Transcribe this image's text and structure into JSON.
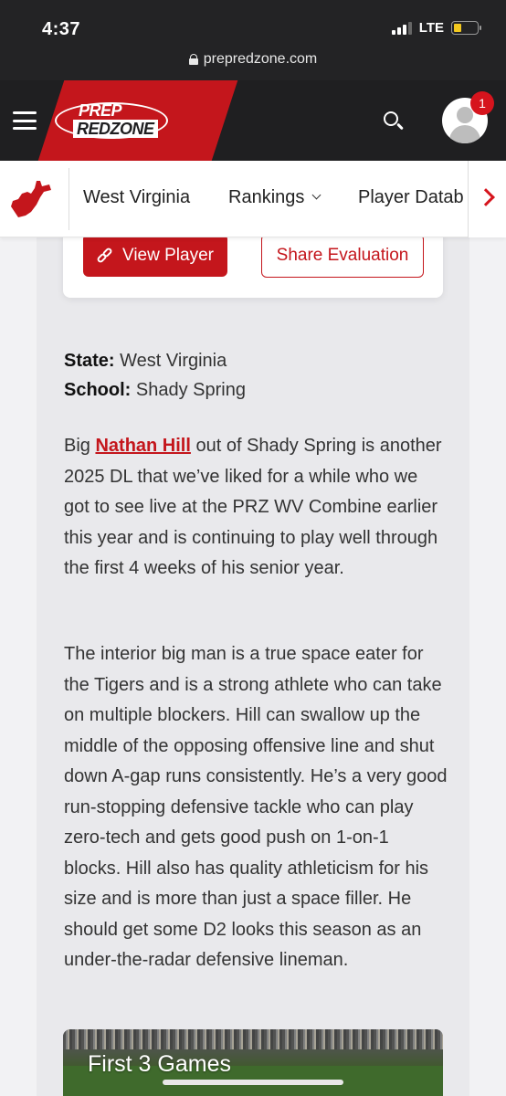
{
  "status_bar": {
    "time": "4:37",
    "network": "LTE",
    "battery_level": 0.35
  },
  "browser": {
    "url": "prepredzone.com"
  },
  "header": {
    "logo_line1": "PREP",
    "logo_line2": "REDZONE",
    "notification_count": "1"
  },
  "subnav": {
    "state_icon": "west-virginia-map-icon",
    "items": [
      "West Virginia",
      "Rankings",
      "Player Datab"
    ]
  },
  "evaluation": {
    "view_button": "View Player",
    "share_button": "Share Evaluation",
    "state_label": "State:",
    "state_value": "West Virginia",
    "school_label": "School:",
    "school_value": "Shady Spring",
    "para1_prefix": "Big ",
    "player_name": "Nathan Hill",
    "para1_suffix": " out of Shady Spring is another 2025 DL that we’ve liked for a while who we got to see live at the PRZ WV Combine earlier this year and is continuing to play well through the first 4 weeks of his senior year.",
    "para2": "The interior big man is a true space eater for the Tigers and is a strong athlete who can take on multiple blockers. Hill can swallow up the middle of the opposing offensive line and shut down A-gap runs consistently. He’s a very good run-stopping defensive tackle who can play zero-tech and gets good push on 1-on-1 blocks. Hill also has quality athleticism for his size and is more than just a space filler. He should get some D2 looks this season as an under-the-radar defensive lineman."
  },
  "video": {
    "title": "First 3 Games"
  },
  "colors": {
    "brand_red": "#c4161c",
    "header_dark": "#1f1f21",
    "badge_red": "#d6141d"
  }
}
